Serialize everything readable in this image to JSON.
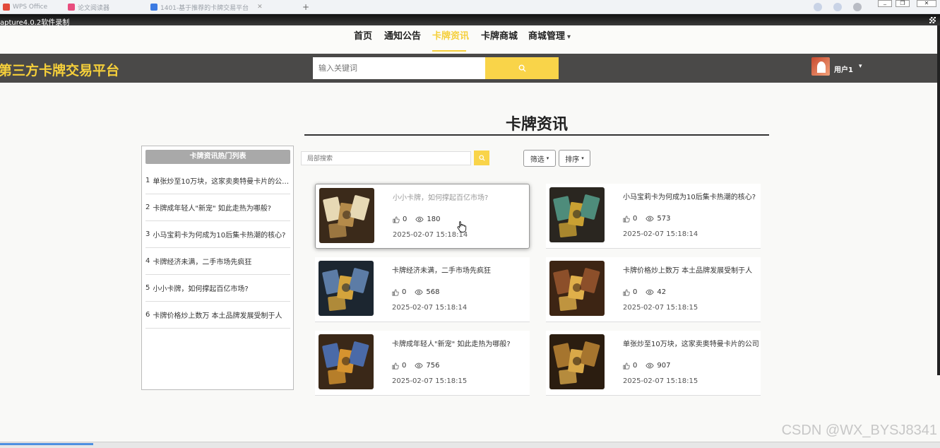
{
  "browser": {
    "tabs": [
      {
        "label": "WPS Office",
        "color": "#e24a3b"
      },
      {
        "label": "论文阅读器",
        "color": "#e84d7e"
      },
      {
        "label": "1401-基于推荐的卡牌交易平台",
        "color": "#3b7ae2"
      }
    ],
    "restore_glyph": "❐",
    "close_glyph": "✕"
  },
  "recorder": {
    "title": "apture4.0.2软件录制"
  },
  "nav": {
    "items": [
      "首页",
      "通知公告",
      "卡牌资讯",
      "卡牌商城",
      "商城管理"
    ],
    "active_index": 2,
    "caret": "▾"
  },
  "header": {
    "brand": "第三方卡牌交易平台",
    "search_placeholder": "输入关键词",
    "username": "用户1",
    "user_caret": "▾"
  },
  "page": {
    "title": "卡牌资讯"
  },
  "sidebar": {
    "title": "卡牌资讯热门列表",
    "items": [
      {
        "num": "1",
        "text": "单张炒至10万块，这家卖奥特曼卡片的公司..."
      },
      {
        "num": "2",
        "text": "卡牌成年轻人\"新宠\" 如此走热为哪般?"
      },
      {
        "num": "3",
        "text": "小马宝莉卡为何成为10后集卡热潮的核心?"
      },
      {
        "num": "4",
        "text": "卡牌经济未满，二手市场先疯狂"
      },
      {
        "num": "5",
        "text": "小小卡牌，如何撑起百亿市场?"
      },
      {
        "num": "6",
        "text": "卡牌价格炒上数万 本土品牌发展受制于人"
      }
    ]
  },
  "filters": {
    "local_search_placeholder": "局部搜索",
    "filter_label": "筛选",
    "sort_label": "排序",
    "caret": "▾"
  },
  "cards": [
    {
      "title": "小小卡牌，如何撑起百亿市场?",
      "likes": "0",
      "views": "180",
      "date": "2025-02-07 15:18:14",
      "palette": [
        "#3b2a1a",
        "#b48a4a",
        "#e7d9b5"
      ]
    },
    {
      "title": "小马宝莉卡为何成为10后集卡热潮的核心?",
      "likes": "0",
      "views": "573",
      "date": "2025-02-07 15:18:14",
      "palette": [
        "#2a2620",
        "#c9a032",
        "#4e8c7b"
      ]
    },
    {
      "title": "卡牌经济未满，二手市场先疯狂",
      "likes": "0",
      "views": "568",
      "date": "2025-02-07 15:18:14",
      "palette": [
        "#1c2630",
        "#d4a43c",
        "#5c7ca6"
      ]
    },
    {
      "title": "卡牌价格炒上数万 本土品牌发展受制于人",
      "likes": "0",
      "views": "42",
      "date": "2025-02-07 15:18:15",
      "palette": [
        "#3d2514",
        "#e0b04a",
        "#8c4f2a"
      ]
    },
    {
      "title": "卡牌成年轻人\"新宠\" 如此走热为哪般?",
      "likes": "0",
      "views": "756",
      "date": "2025-02-07 15:18:15",
      "palette": [
        "#3a2818",
        "#d6932f",
        "#4a6aa8"
      ]
    },
    {
      "title": "单张炒至10万块，这家卖奥特曼卡片的公司",
      "likes": "0",
      "views": "907",
      "date": "2025-02-07 15:18:15",
      "palette": [
        "#2b1d10",
        "#d8a848",
        "#a6752e"
      ]
    }
  ],
  "watermark": "CSDN @WX_BYSJ8341",
  "colors": {
    "accent": "#f5cf3a",
    "header_bg": "#4a4948",
    "button_yellow": "#f9d449"
  }
}
